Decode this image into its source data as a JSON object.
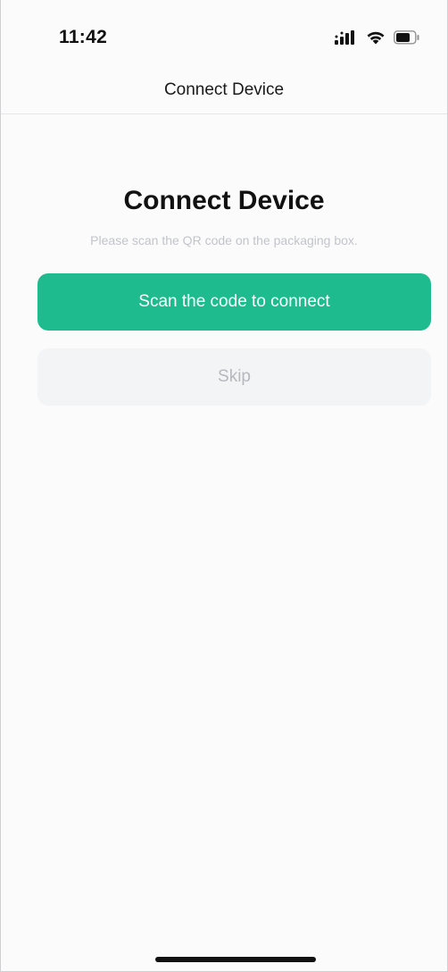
{
  "status_bar": {
    "time": "11:42",
    "icons": [
      "cellular-signal-icon",
      "wifi-icon",
      "battery-icon"
    ]
  },
  "nav": {
    "title": "Connect Device"
  },
  "main": {
    "heading": "Connect Device",
    "subtitle": "Please scan the QR code on the packaging box.",
    "primary_button_label": "Scan the code to connect",
    "secondary_button_label": "Skip"
  },
  "colors": {
    "accent": "#1dbb8d",
    "secondary_button_bg": "#f3f4f6",
    "secondary_text": "#b6b8bd"
  }
}
